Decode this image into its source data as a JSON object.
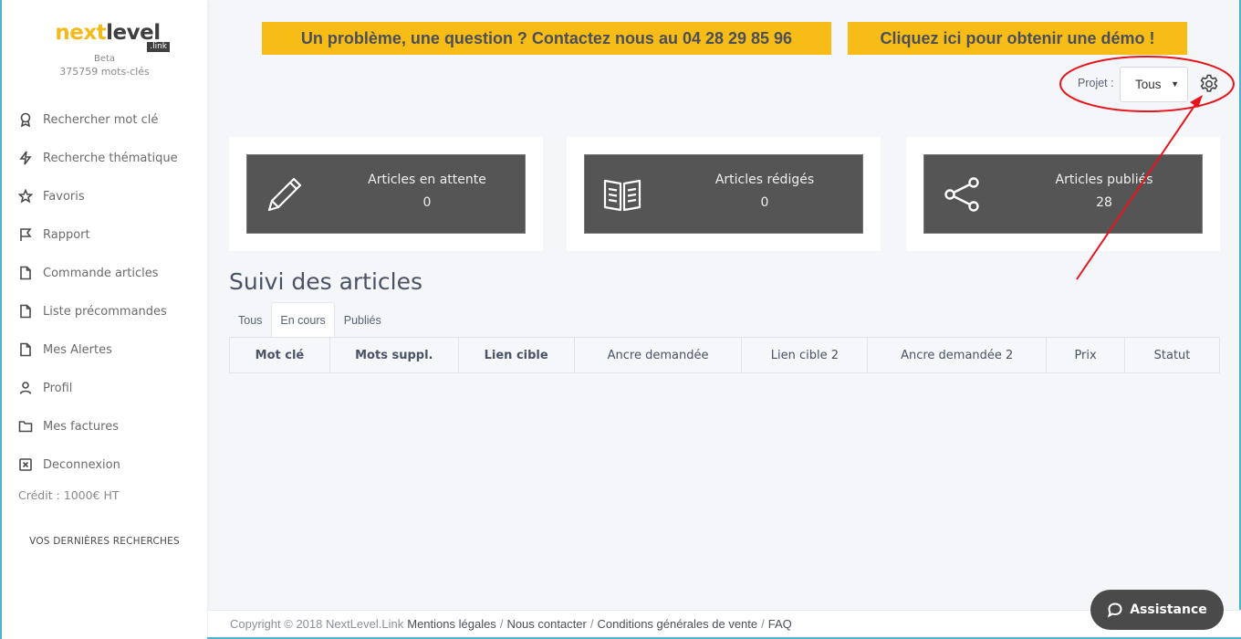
{
  "brand": {
    "logo_next": "next",
    "logo_level": "level",
    "logo_link": ".link",
    "beta": "Beta",
    "keywords_count": "375759 mots-clés"
  },
  "sidebar": {
    "items": [
      {
        "label": "Rechercher mot clé",
        "icon": "award-icon"
      },
      {
        "label": "Recherche thématique",
        "icon": "lightning-icon"
      },
      {
        "label": "Favoris",
        "icon": "star-icon"
      },
      {
        "label": "Rapport",
        "icon": "flag-icon"
      },
      {
        "label": "Commande articles",
        "icon": "file-icon"
      },
      {
        "label": "Liste précommandes",
        "icon": "file-icon"
      },
      {
        "label": "Mes Alertes",
        "icon": "file-icon"
      },
      {
        "label": "Profil",
        "icon": "user-icon"
      },
      {
        "label": "Mes factures",
        "icon": "folder-icon"
      },
      {
        "label": "Deconnexion",
        "icon": "close-box-icon"
      }
    ],
    "credit": "Crédit : 1000€ HT",
    "recent_searches": "VOS DERNIÈRES RECHERCHES"
  },
  "banners": {
    "contact": "Un problème, une question ? Contactez nous au 04 28 29 85 96",
    "demo": "Cliquez ici pour obtenir une démo !"
  },
  "project": {
    "label": "Projet :",
    "selected": "Tous",
    "caret": "▼"
  },
  "stats": [
    {
      "title": "Articles en attente",
      "value": "0",
      "icon": "pencil-icon"
    },
    {
      "title": "Articles rédigés",
      "value": "0",
      "icon": "book-icon"
    },
    {
      "title": "Articles publiés",
      "value": "28",
      "icon": "share-icon"
    }
  ],
  "tracking": {
    "title": "Suivi des articles",
    "tabs": [
      {
        "label": "Tous",
        "active": false
      },
      {
        "label": "En cours",
        "active": true
      },
      {
        "label": "Publiés",
        "active": false
      }
    ],
    "columns": [
      "Mot clé",
      "Mots suppl.",
      "Lien cible",
      "Ancre demandée",
      "Lien cible 2",
      "Ancre demandée 2",
      "Prix",
      "Statut"
    ],
    "rows": []
  },
  "footer": {
    "copyright": "Copyright © 2018 NextLevel.Link",
    "links": [
      "Mentions légales",
      "Nous contacter",
      "Conditions générales de vente",
      "FAQ"
    ],
    "separator": "/"
  },
  "assistance": {
    "label": "Assistance"
  },
  "colors": {
    "accent_yellow": "#f8bc16",
    "card_dark": "#555555",
    "annotation_red": "#e8141b",
    "frame_blue": "#4fb3cf"
  }
}
